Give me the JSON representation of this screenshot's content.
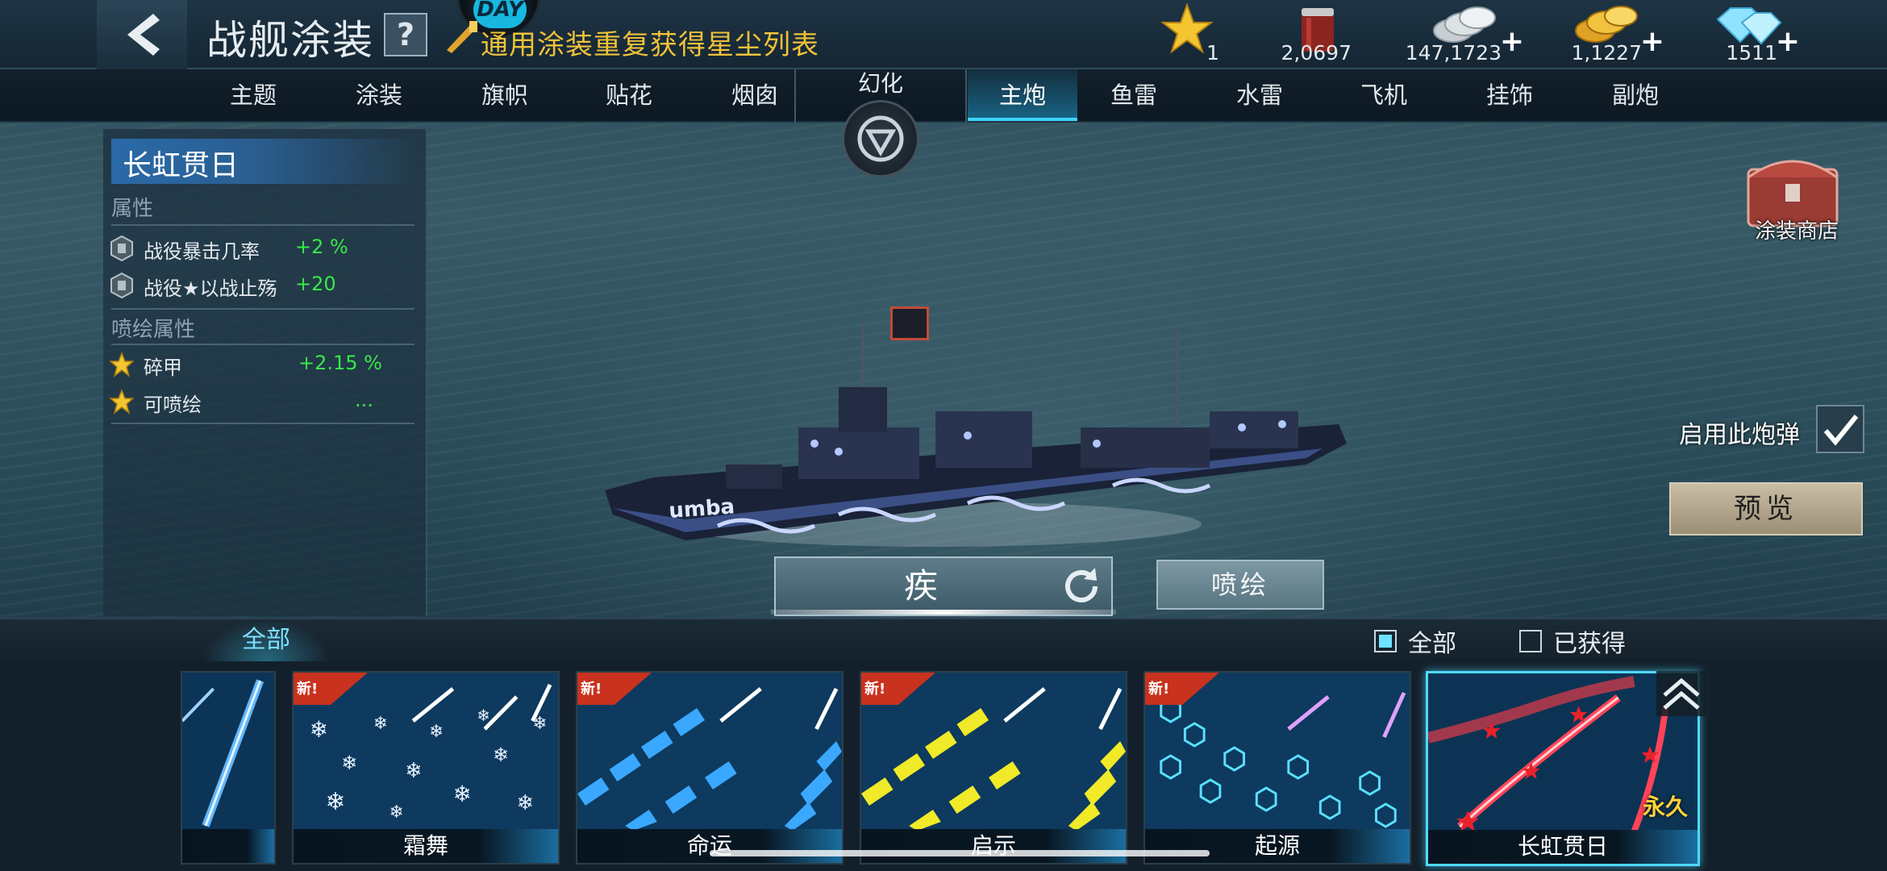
{
  "header": {
    "title": "战舰涂装",
    "help_label": "?",
    "day_badge": "DAY",
    "notice": "通用涂装重复获得星尘列表"
  },
  "currencies": [
    {
      "icon": "star-icon",
      "value": "1"
    },
    {
      "icon": "paint-bucket-icon",
      "value": "2,0697"
    },
    {
      "icon": "silver-coins-icon",
      "value": "147,1723",
      "plus": "+"
    },
    {
      "icon": "gold-coins-icon",
      "value": "1,1227",
      "plus": "+"
    },
    {
      "icon": "diamond-icon",
      "value": "1511",
      "plus": "+"
    }
  ],
  "tabs": [
    {
      "label": "主题"
    },
    {
      "label": "涂装"
    },
    {
      "label": "旗帜"
    },
    {
      "label": "贴花"
    },
    {
      "label": "烟囱"
    },
    {
      "label": "主炮",
      "active": true
    },
    {
      "label": "鱼雷"
    },
    {
      "label": "水雷"
    },
    {
      "label": "飞机"
    },
    {
      "label": "挂饰"
    },
    {
      "label": "副炮"
    }
  ],
  "transform_label": "幻化",
  "stats": {
    "skin_name": "长虹贯日",
    "section_attr": "属性",
    "attrs": [
      {
        "name": "战役暴击几率",
        "value": "+2 %"
      },
      {
        "name": "战役★以战止殇",
        "value": "+20"
      }
    ],
    "section_spray": "喷绘属性",
    "spray_attrs": [
      {
        "name": "碎甲",
        "value": "+2.15 %"
      },
      {
        "name": "可喷绘",
        "value": "..."
      }
    ]
  },
  "ship": {
    "hull_text": "umba"
  },
  "right": {
    "shop_label": "涂装商店",
    "enable_label": "启用此炮弹",
    "preview_label": "预览"
  },
  "ammo": {
    "name": "疾",
    "spray_label": "喷绘"
  },
  "filters": {
    "tab_all": "全部",
    "opt_all": "全部",
    "opt_owned": "已获得"
  },
  "cards": [
    {
      "label": "",
      "new": false,
      "style": "blue-streak"
    },
    {
      "label": "霜舞",
      "new": true,
      "new_text": "新!",
      "style": "snow"
    },
    {
      "label": "命运",
      "new": true,
      "new_text": "新!",
      "style": "blue-chevron"
    },
    {
      "label": "启示",
      "new": true,
      "new_text": "新!",
      "style": "yellow-chevron"
    },
    {
      "label": "起源",
      "new": true,
      "new_text": "新!",
      "style": "hexagon"
    },
    {
      "label": "长虹贯日",
      "new": false,
      "perm": "永久",
      "selected": true,
      "style": "red-star"
    }
  ],
  "colors": {
    "accent": "#3fd2ff",
    "stat_green": "#39e84a",
    "notice_gold": "#f0c238",
    "new_tag_red": "#c8321e"
  }
}
